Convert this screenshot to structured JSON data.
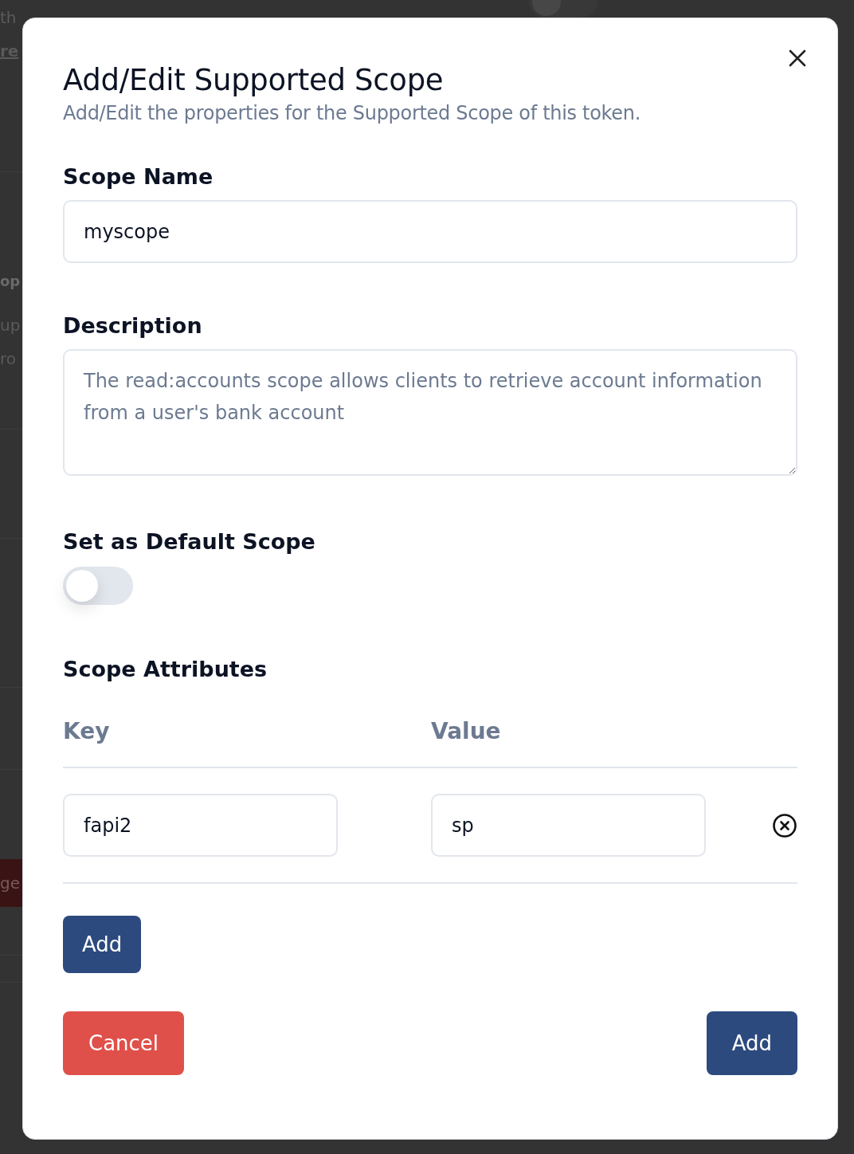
{
  "background": {
    "fragments": [
      {
        "kind": "text",
        "text": "th"
      },
      {
        "kind": "link",
        "text": "re"
      },
      {
        "kind": "heading",
        "text": "op"
      },
      {
        "kind": "text",
        "text": "up"
      },
      {
        "kind": "text",
        "text": "ro"
      },
      {
        "kind": "button",
        "text": "ge"
      }
    ],
    "toggle": {
      "on": false
    }
  },
  "dialog": {
    "title": "Add/Edit Supported Scope",
    "subtitle": "Add/Edit the properties for the Supported Scope of this token.",
    "scope_name": {
      "label": "Scope Name",
      "value": "myscope"
    },
    "description": {
      "label": "Description",
      "placeholder": "The read:accounts scope allows clients to retrieve account information from a user's bank account"
    },
    "default_scope": {
      "label": "Set as Default Scope",
      "on": false
    },
    "attributes": {
      "title": "Scope Attributes",
      "columns": [
        "Key",
        "Value"
      ],
      "rows": [
        {
          "key": "fapi2",
          "value": "sp"
        }
      ],
      "add_button": "Add"
    },
    "buttons": [
      {
        "kind": "cancel",
        "label": "Cancel"
      },
      {
        "kind": "primary",
        "label": "Add"
      }
    ]
  }
}
